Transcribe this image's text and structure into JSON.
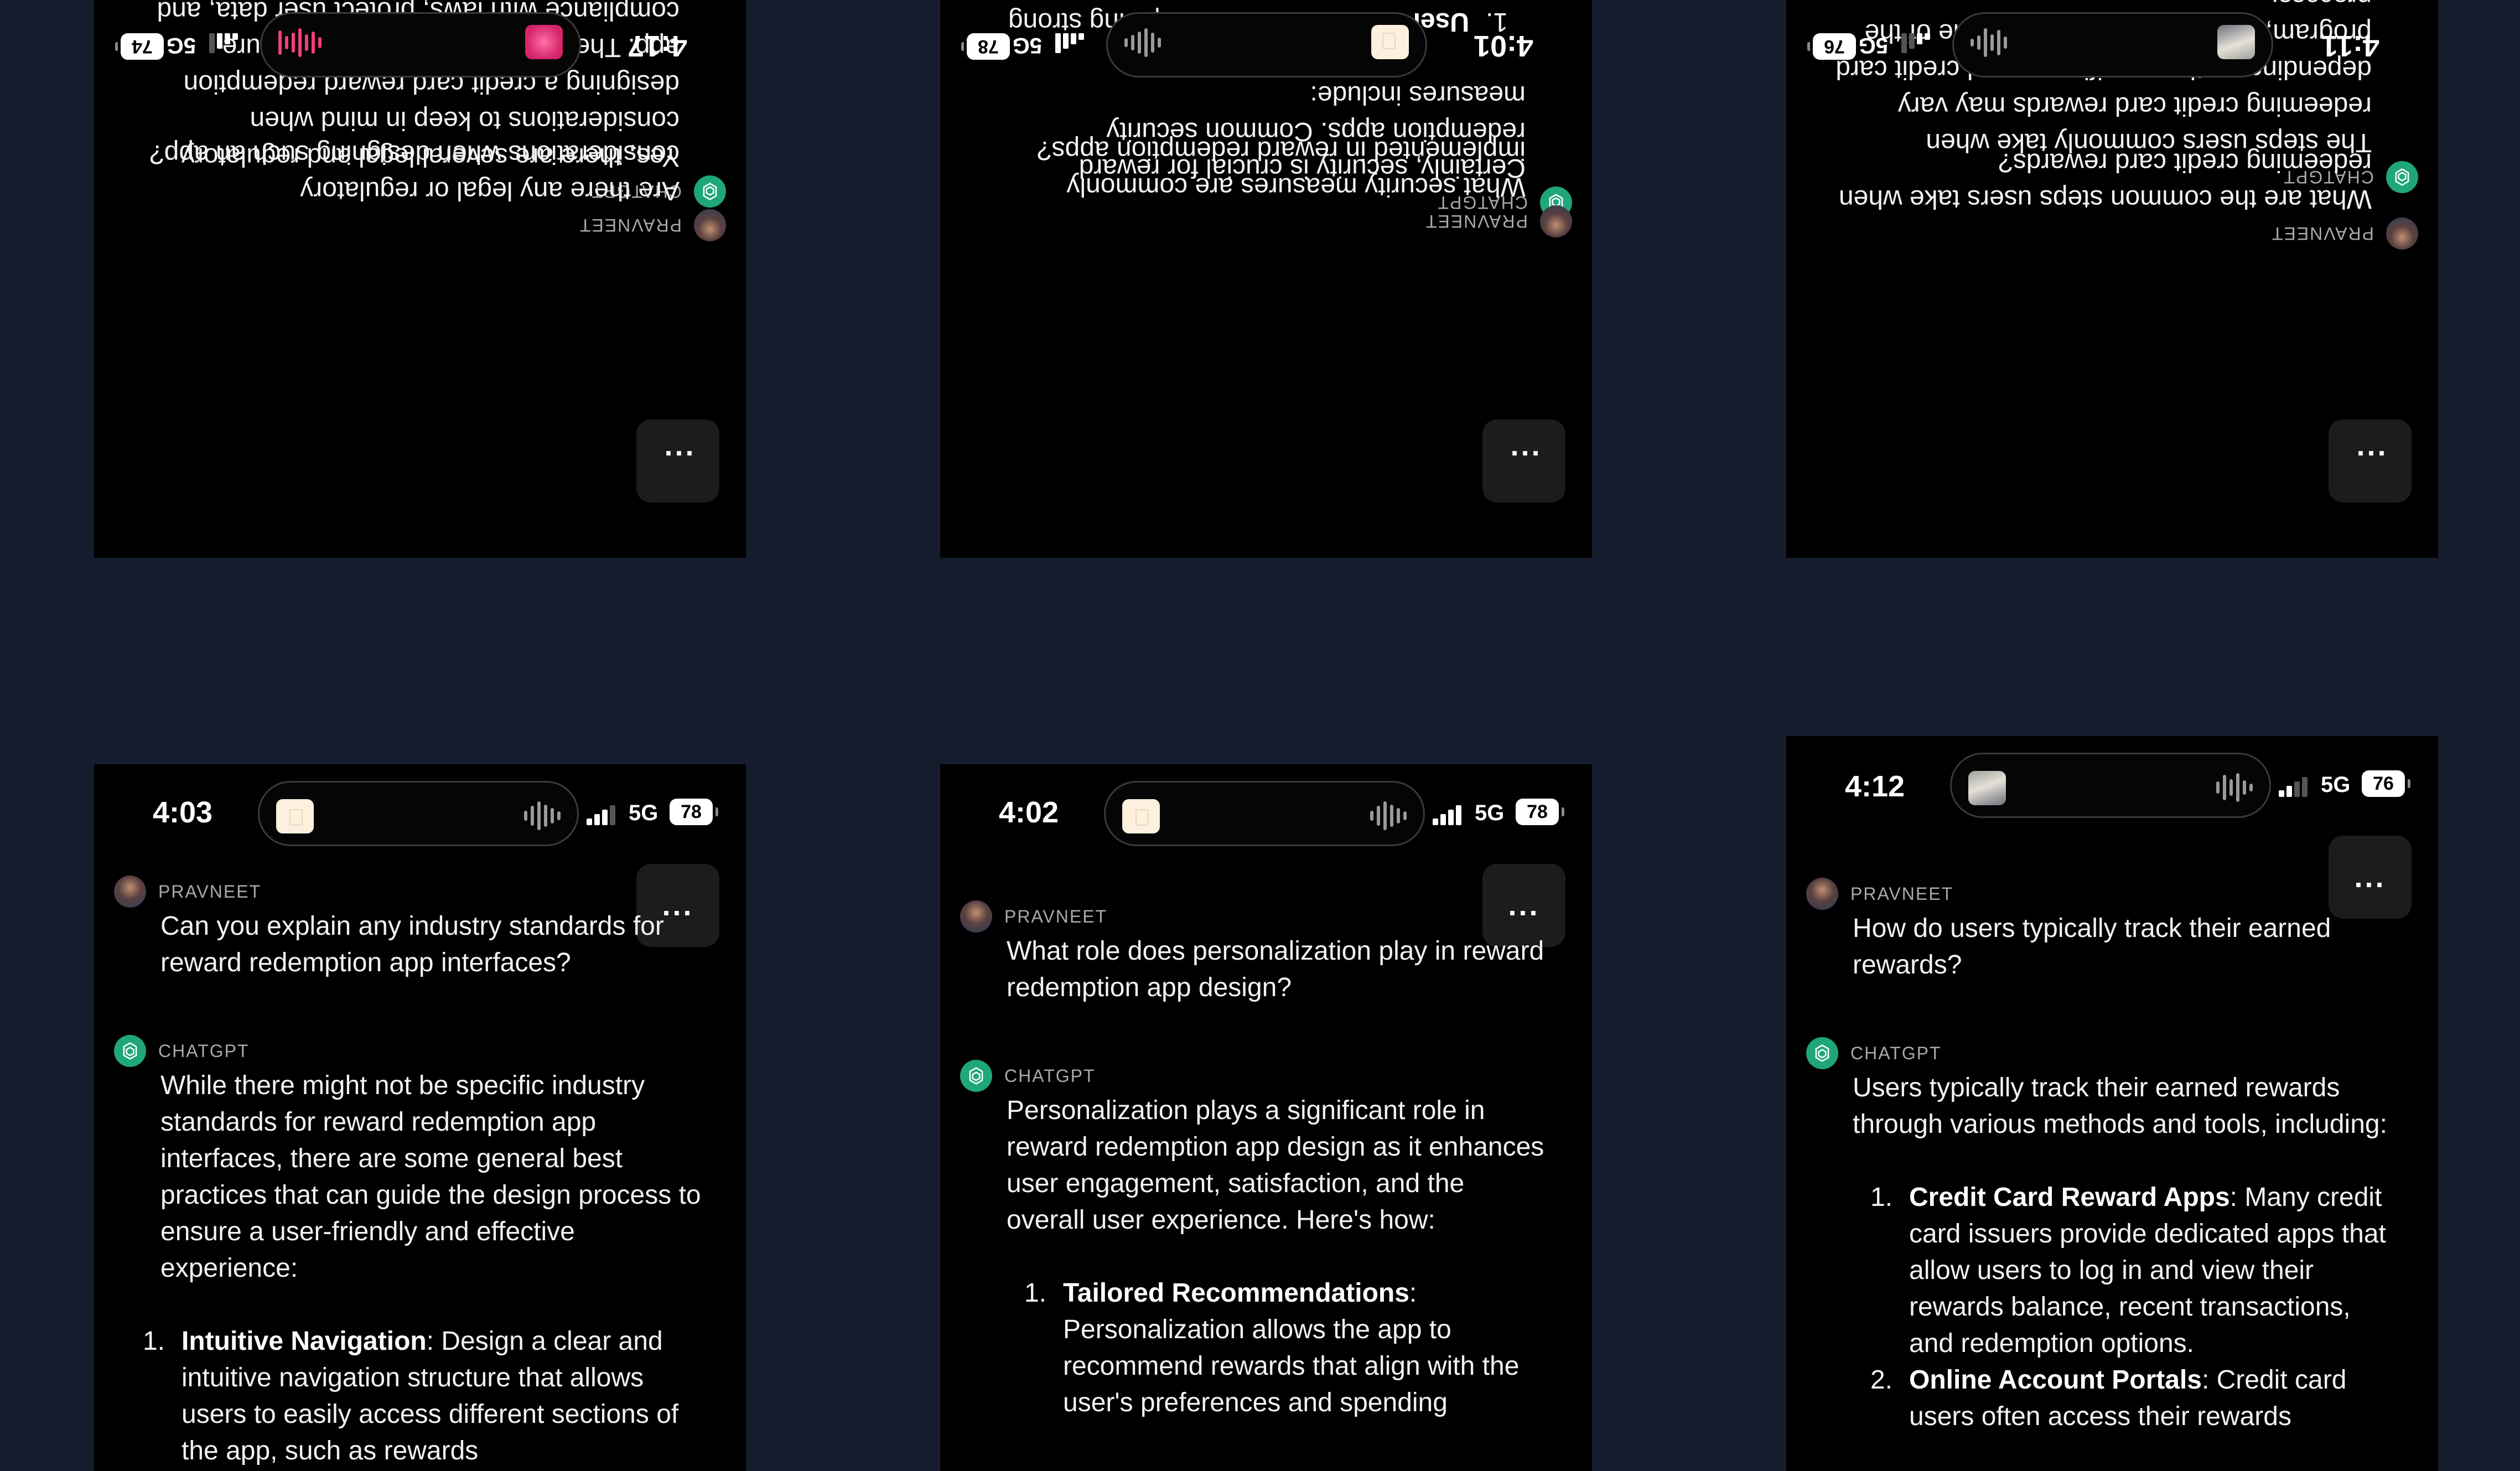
{
  "panels": [
    {
      "id": "top-left",
      "time": "4:17",
      "network": "5G",
      "battery": "74",
      "thumb": "pink",
      "wave": "pink",
      "more_label": "...",
      "user_name": "PRAVNEET",
      "question": "Are there any legal or regulatory considerations when designing such an app?",
      "bot_name": "CHATGPT",
      "answer": "Yes, there are several legal and regulatory considerations to keep in mind when designing a credit card reward redemption app. These considerations help ensure compliance with laws, protect user data, and maintain transparency. Some key"
    },
    {
      "id": "top-middle",
      "time": "4:01",
      "network": "5G",
      "battery": "78",
      "thumb": "doc",
      "wave": "gray",
      "more_label": "...",
      "user_name": "PRAVNEET",
      "question": "What security measures are commonly implemented in reward redemption apps?",
      "bot_name": "CHATGPT",
      "answer": "Certainly, security is crucial for reward redemption apps. Common security measures include:",
      "list": [
        {
          "num": "1.",
          "title": "User Authentication",
          "rest": ": Requiring strong passwords or passphrases for"
        }
      ]
    },
    {
      "id": "top-right",
      "time": "4:11",
      "network": "5G",
      "battery": "76",
      "thumb": "photo",
      "wave": "gray",
      "more_label": "...",
      "user_name": "PRAVNEET",
      "question": "What are the common steps users take when redeeming credit card rewards?",
      "bot_name": "CHATGPT",
      "answer": "The steps users commonly take when redeeming credit card rewards may vary depending on the specific app and credit card program, but here's a general outline of the process:"
    },
    {
      "id": "bottom-left",
      "time": "4:03",
      "network": "5G",
      "battery": "78",
      "thumb": "doc",
      "wave": "gray",
      "more_label": "...",
      "user_name": "PRAVNEET",
      "question": "Can you explain any industry standards for reward redemption app interfaces?",
      "bot_name": "CHATGPT",
      "answer": "While there might not be specific industry standards for reward redemption app interfaces, there are some general best practices that can guide the design process to ensure a user-friendly and effective experience:",
      "list": [
        {
          "num": "1.",
          "title": "Intuitive Navigation",
          "rest": ": Design a clear and intuitive navigation structure that allows users to easily access different sections of the app, such as rewards"
        }
      ]
    },
    {
      "id": "bottom-middle",
      "time": "4:02",
      "network": "5G",
      "battery": "78",
      "thumb": "doc",
      "wave": "gray",
      "more_label": "...",
      "user_name": "PRAVNEET",
      "question": "What role does personalization play in reward redemption app design?",
      "bot_name": "CHATGPT",
      "answer": "Personalization plays a significant role in reward redemption app design as it enhances user engagement, satisfaction, and the overall user experience. Here's how:",
      "list": [
        {
          "num": "1.",
          "title": "Tailored Recommendations",
          "rest": ": Personalization allows the app to recommend rewards that align with the user's preferences and spending"
        }
      ]
    },
    {
      "id": "bottom-right",
      "time": "4:12",
      "network": "5G",
      "battery": "76",
      "thumb": "photo",
      "wave": "gray",
      "more_label": "...",
      "user_name": "PRAVNEET",
      "question": "How do users typically track their earned rewards?",
      "bot_name": "CHATGPT",
      "answer": "Users typically track their earned rewards through various methods and tools, including:",
      "list": [
        {
          "num": "1.",
          "title": "Credit Card Reward Apps",
          "rest": ": Many credit card issuers provide dedicated apps that allow users to log in and view their rewards balance, recent transactions, and redemption options."
        },
        {
          "num": "2.",
          "title": "Online Account Portals",
          "rest": ": Credit card users often access their rewards"
        }
      ]
    }
  ]
}
